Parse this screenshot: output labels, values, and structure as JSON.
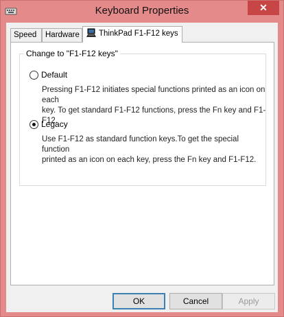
{
  "window": {
    "title": "Keyboard Properties",
    "close_symbol": "✕",
    "app_icon": "keyboard-icon"
  },
  "tabs": [
    {
      "label": "Speed",
      "active": false
    },
    {
      "label": "Hardware",
      "active": false
    },
    {
      "label": "ThinkPad F1-F12 keys",
      "active": true,
      "icon": "thinkpad-icon"
    }
  ],
  "group": {
    "legend": "Change to \"F1-F12 keys\"",
    "options": [
      {
        "label": "Default",
        "selected": false,
        "description_line1": "Pressing F1-F12 initiates special functions printed as an icon on each",
        "description_line2": "key. To get standard F1-F12 functions, press the Fn key and F1-F12."
      },
      {
        "label": "Legacy",
        "selected": true,
        "description_line1": "Use F1-F12 as standard function keys.To get the special function",
        "description_line2": "printed as an icon on each key, press the Fn key and F1-F12."
      }
    ]
  },
  "buttons": {
    "ok": "OK",
    "cancel": "Cancel",
    "apply": "Apply"
  },
  "colors": {
    "titlebar": "#e58a8a",
    "close": "#c84545",
    "client": "#f0f0f0"
  }
}
